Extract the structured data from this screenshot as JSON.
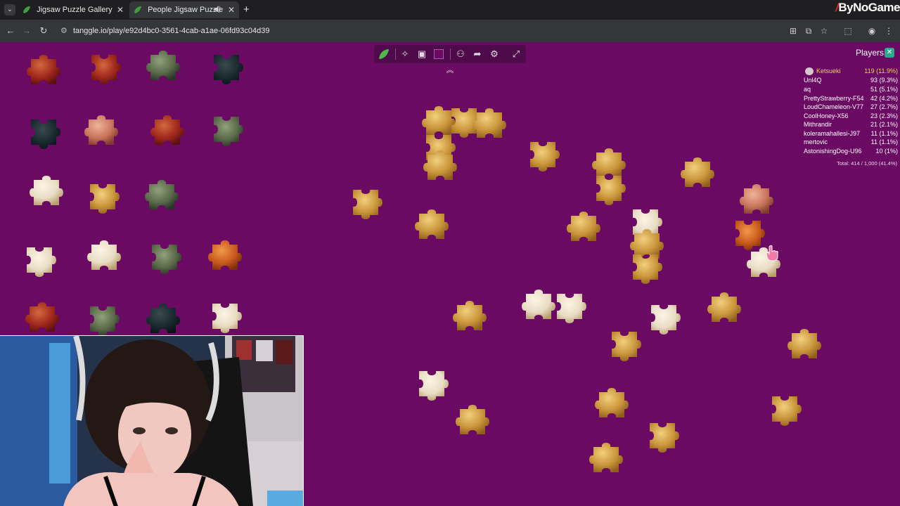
{
  "browser": {
    "tabs": [
      {
        "title": "Jigsaw Puzzle Gallery",
        "active": false
      },
      {
        "title": "People Jigsaw Puzzle",
        "active": true
      }
    ],
    "url": "tanggle.io/play/e92d4bc0-3561-4cab-a1ae-06fd93c04d39",
    "brand_by": "By",
    "brand_name": "NoGame"
  },
  "toolbar": {
    "icons": [
      "tanggle-logo-icon",
      "edge-pieces-icon",
      "box-image-icon",
      "background-color-swatch",
      "players-icon",
      "share-icon",
      "settings-icon",
      "fullscreen-icon"
    ],
    "background_color": "#6a0a63"
  },
  "players_panel": {
    "title": "Players",
    "players": [
      {
        "name": "Ketsueki",
        "score": "119 (11.9%)"
      },
      {
        "name": "Unl4Q",
        "score": "93 (9.3%)"
      },
      {
        "name": "aq",
        "score": "51 (5.1%)"
      },
      {
        "name": "PrettyStrawberry-F54",
        "score": "42 (4.2%)"
      },
      {
        "name": "LoudChameleon-V77",
        "score": "27 (2.7%)"
      },
      {
        "name": "CoolHoney-X56",
        "score": "23 (2.3%)"
      },
      {
        "name": "Mithrandir",
        "score": "21 (2.1%)"
      },
      {
        "name": "koleramahallesi-J97",
        "score": "11 (1.1%)"
      },
      {
        "name": "mertovic",
        "score": "11 (1.1%)"
      },
      {
        "name": "AstonishingDog-U96",
        "score": "10 (1%)"
      }
    ],
    "total": "Total: 414 / 1,000 (41.4%)"
  },
  "colors": {
    "board_background": "#6a0a63",
    "leader_highlight": "#f0d84a",
    "piece_gold": "#c8943a",
    "piece_light": "#e8dcc4"
  }
}
